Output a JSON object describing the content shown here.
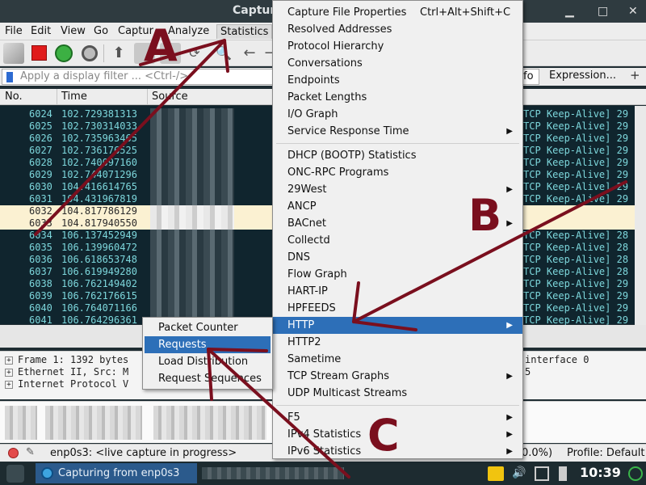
{
  "window": {
    "title": "Capturi"
  },
  "menubar": {
    "items": [
      "File",
      "Edit",
      "View",
      "Go",
      "Captur",
      "Analyze",
      "Statistics"
    ]
  },
  "filter": {
    "placeholder": "Apply a display filter ... <Ctrl-/>",
    "info_fragment": "fo",
    "expression_label": "Expression...",
    "add_label": "+"
  },
  "columns": {
    "no": "No.",
    "time": "Time",
    "source": "Source"
  },
  "packets": [
    {
      "no": "6024",
      "time": "102.729381313",
      "info": "TCP Keep-Alive] 29"
    },
    {
      "no": "6025",
      "time": "102.730314033",
      "info": "TCP Keep-Alive] 29"
    },
    {
      "no": "6026",
      "time": "102.735963465",
      "info": "TCP Keep-Alive] 29"
    },
    {
      "no": "6027",
      "time": "102.736176525",
      "info": "TCP Keep-Alive] 29"
    },
    {
      "no": "6028",
      "time": "102.740097160",
      "info": "TCP Keep-Alive] 29"
    },
    {
      "no": "6029",
      "time": "102.744071296",
      "info": "TCP Keep-Alive] 29"
    },
    {
      "no": "6030",
      "time": "104.416614765",
      "info": "TCP Keep-Alive] 29"
    },
    {
      "no": "6031",
      "time": "104.431967819",
      "info": "TCP Keep-Alive] 29"
    },
    {
      "no": "6032",
      "time": "104.817786129",
      "info": ""
    },
    {
      "no": "6033",
      "time": "104.817940550",
      "info": ""
    },
    {
      "no": "6034",
      "time": "106.137452949",
      "info": "TCP Keep-Alive] 28"
    },
    {
      "no": "6035",
      "time": "106.139960472",
      "info": "TCP Keep-Alive] 28"
    },
    {
      "no": "6036",
      "time": "106.618653748",
      "info": "TCP Keep-Alive] 28"
    },
    {
      "no": "6037",
      "time": "106.619949280",
      "info": "TCP Keep-Alive] 28"
    },
    {
      "no": "6038",
      "time": "106.762149402",
      "info": "TCP Keep-Alive] 29"
    },
    {
      "no": "6039",
      "time": "106.762176615",
      "info": "TCP Keep-Alive] 29"
    },
    {
      "no": "6040",
      "time": "106.764071166",
      "info": "TCP Keep-Alive] 29"
    },
    {
      "no": "6041",
      "time": "106.764296361",
      "info": "TCP Keep-Alive] 29"
    }
  ],
  "details": [
    {
      "left": "Frame 1: 1392 bytes",
      "right": "interface 0"
    },
    {
      "left": "Ethernet II, Src: M",
      "right": "5"
    },
    {
      "left": "Internet Protocol V",
      "right": ""
    }
  ],
  "statusbar": {
    "capture_label": "enp0s3: <live capture in progress>",
    "percent": "0.0%)",
    "profile": "Profile: Default"
  },
  "taskbar": {
    "task_label": "Capturing from enp0s3",
    "clock": "10:39"
  },
  "statistics_menu": {
    "items": [
      {
        "label": "Capture File Properties",
        "shortcut": "Ctrl+Alt+Shift+C",
        "submenu": false
      },
      {
        "label": "Resolved Addresses",
        "shortcut": "",
        "submenu": false
      },
      {
        "label": "Protocol Hierarchy",
        "shortcut": "",
        "submenu": false
      },
      {
        "label": "Conversations",
        "shortcut": "",
        "submenu": false
      },
      {
        "label": "Endpoints",
        "shortcut": "",
        "submenu": false
      },
      {
        "label": "Packet Lengths",
        "shortcut": "",
        "submenu": false
      },
      {
        "label": "I/O Graph",
        "shortcut": "",
        "submenu": false
      },
      {
        "label": "Service Response Time",
        "shortcut": "",
        "submenu": true
      },
      {
        "label": "DHCP (BOOTP) Statistics",
        "shortcut": "",
        "submenu": false
      },
      {
        "label": "ONC-RPC Programs",
        "shortcut": "",
        "submenu": false
      },
      {
        "label": "29West",
        "shortcut": "",
        "submenu": true
      },
      {
        "label": "ANCP",
        "shortcut": "",
        "submenu": false
      },
      {
        "label": "BACnet",
        "shortcut": "",
        "submenu": true
      },
      {
        "label": "Collectd",
        "shortcut": "",
        "submenu": false
      },
      {
        "label": "DNS",
        "shortcut": "",
        "submenu": false
      },
      {
        "label": "Flow Graph",
        "shortcut": "",
        "submenu": false
      },
      {
        "label": "HART-IP",
        "shortcut": "",
        "submenu": false
      },
      {
        "label": "HPFEEDS",
        "shortcut": "",
        "submenu": false
      },
      {
        "label": "HTTP",
        "shortcut": "",
        "submenu": true
      },
      {
        "label": "HTTP2",
        "shortcut": "",
        "submenu": false
      },
      {
        "label": "Sametime",
        "shortcut": "",
        "submenu": false
      },
      {
        "label": "TCP Stream Graphs",
        "shortcut": "",
        "submenu": true
      },
      {
        "label": "UDP Multicast Streams",
        "shortcut": "",
        "submenu": false
      },
      {
        "label": "F5",
        "shortcut": "",
        "submenu": true
      },
      {
        "label": "IPv4 Statistics",
        "shortcut": "",
        "submenu": true
      },
      {
        "label": "IPv6 Statistics",
        "shortcut": "",
        "submenu": true
      }
    ]
  },
  "http_submenu": {
    "items": [
      "Packet Counter",
      "Requests",
      "Load Distribution",
      "Request Sequences"
    ]
  },
  "annotations": {
    "a": "A",
    "b": "B",
    "c": "C",
    "color": "#7a0f1e"
  },
  "colors": {
    "selection": "#2d6fb8",
    "packet_bg": "#10252e",
    "packet_text": "#7dd7dc",
    "highlight_row": "#fbf1d2"
  }
}
